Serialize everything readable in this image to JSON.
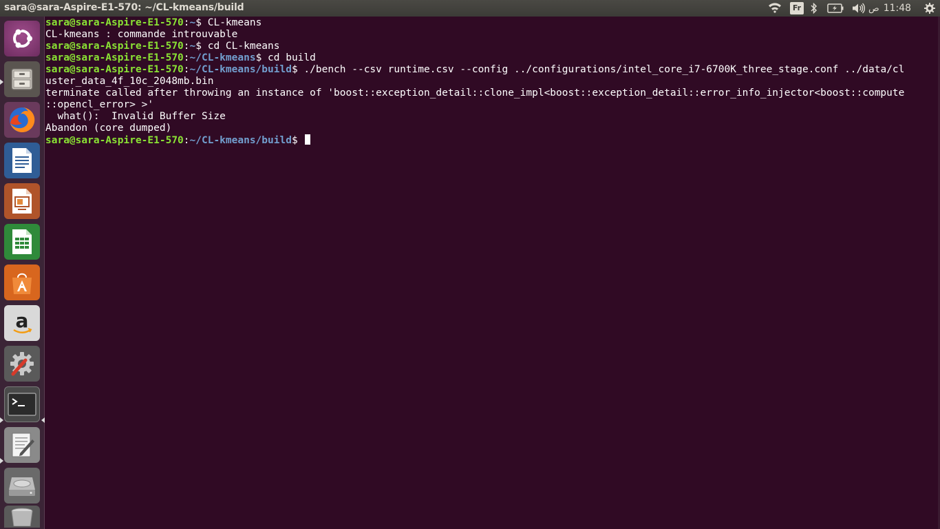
{
  "window": {
    "title": "sara@sara-Aspire-E1-570: ~/CL-kmeans/build"
  },
  "top_panel": {
    "keyboard_layout": "Fr",
    "clock_period": "ص",
    "clock_time": "11:48",
    "icons": [
      "wifi-icon",
      "keyboard-layout-indicator",
      "bluetooth-icon",
      "battery-icon",
      "volume-icon",
      "settings-gear-icon"
    ]
  },
  "launcher": {
    "items": [
      {
        "name": "ubuntu-dash",
        "icon": "ubuntu-logo-icon"
      },
      {
        "name": "files",
        "icon": "file-cabinet-icon",
        "running": true
      },
      {
        "name": "firefox",
        "icon": "firefox-icon"
      },
      {
        "name": "libreoffice-writer",
        "icon": "writer-icon"
      },
      {
        "name": "libreoffice-impress",
        "icon": "impress-icon"
      },
      {
        "name": "libreoffice-calc",
        "icon": "calc-icon"
      },
      {
        "name": "ubuntu-software",
        "icon": "software-bag-icon"
      },
      {
        "name": "amazon",
        "icon": "amazon-icon"
      },
      {
        "name": "system-settings",
        "icon": "settings-wrench-icon"
      },
      {
        "name": "terminal",
        "icon": "terminal-icon",
        "running": true,
        "focused": true
      },
      {
        "name": "text-editor",
        "icon": "text-editor-icon",
        "running": true
      },
      {
        "name": "disk",
        "icon": "hard-disk-icon"
      },
      {
        "name": "trash",
        "icon": "trash-icon"
      }
    ]
  },
  "terminal": {
    "prompt_user": "sara@sara-Aspire-E1-570",
    "lines": [
      {
        "user": "sara@sara-Aspire-E1-570",
        "sep": ":",
        "path": "~",
        "dollar": "$ ",
        "text": "CL-kmeans"
      },
      {
        "text": "CL-kmeans : commande introuvable"
      },
      {
        "user": "sara@sara-Aspire-E1-570",
        "sep": ":",
        "path": "~",
        "dollar": "$ ",
        "text": "cd CL-kmeans"
      },
      {
        "user": "sara@sara-Aspire-E1-570",
        "sep": ":",
        "path": "~/CL-kmeans",
        "dollar": "$ ",
        "text": "cd build"
      },
      {
        "user": "sara@sara-Aspire-E1-570",
        "sep": ":",
        "path": "~/CL-kmeans/build",
        "dollar": "$ ",
        "text": "./bench --csv runtime.csv --config ../configurations/intel_core_i7-6700K_three_stage.conf ../data/cl"
      },
      {
        "text": "uster_data_4f_10c_2048mb.bin"
      },
      {
        "text": "terminate called after throwing an instance of 'boost::exception_detail::clone_impl<boost::exception_detail::error_info_injector<boost::compute"
      },
      {
        "text": "::opencl_error> >'"
      },
      {
        "text": "  what():  Invalid Buffer Size"
      },
      {
        "text": "Abandon (core dumped)"
      },
      {
        "user": "sara@sara-Aspire-E1-570",
        "sep": ":",
        "path": "~/CL-kmeans/build",
        "dollar": "$ ",
        "text": ""
      }
    ]
  },
  "colors": {
    "terminal_bg": "#300a24",
    "prompt_user": "#8ae234",
    "prompt_path": "#729fcf",
    "text": "#ffffff",
    "panel": "#3c3b37"
  }
}
